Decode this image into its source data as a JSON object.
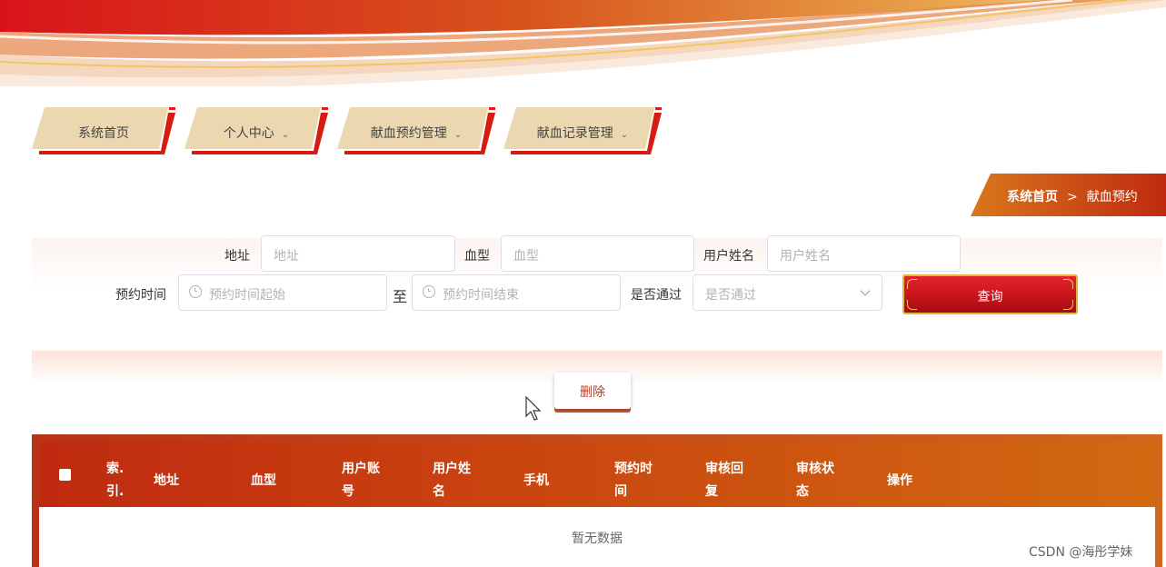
{
  "nav": {
    "items": [
      {
        "label": "系统首页",
        "has_dropdown": false
      },
      {
        "label": "个人中心",
        "has_dropdown": true
      },
      {
        "label": "献血预约管理",
        "has_dropdown": true
      },
      {
        "label": "献血记录管理",
        "has_dropdown": true
      }
    ],
    "dropdown_icon": "chevron-down-icon"
  },
  "breadcrumb": {
    "home": "系统首页",
    "separator": ">",
    "current": "献血预约"
  },
  "search": {
    "address": {
      "label": "地址",
      "placeholder": "地址"
    },
    "blood_type": {
      "label": "血型",
      "placeholder": "血型"
    },
    "user_name": {
      "label": "用户姓名",
      "placeholder": "用户姓名"
    },
    "time": {
      "label": "预约时间",
      "start_placeholder": "预约时间起始",
      "range_sep": "至",
      "end_placeholder": "预约时间结束",
      "icon": "clock-icon"
    },
    "passed": {
      "label": "是否通过",
      "placeholder": "是否通过",
      "icon": "chevron-down-icon"
    },
    "query_label": "查询"
  },
  "actions": {
    "delete_label": "删除"
  },
  "table": {
    "columns": [
      {
        "label": "索.",
        "label2": "引."
      },
      {
        "label": "地址",
        "label2": ""
      },
      {
        "label": "血型",
        "label2": ""
      },
      {
        "label": "用户账",
        "label2": "号"
      },
      {
        "label": "用户姓",
        "label2": "名"
      },
      {
        "label": "手机",
        "label2": ""
      },
      {
        "label": "预约时",
        "label2": "间"
      },
      {
        "label": "审核回",
        "label2": "复"
      },
      {
        "label": "审核状",
        "label2": "态"
      },
      {
        "label": "操作",
        "label2": ""
      }
    ],
    "empty_text": "暂无数据"
  },
  "watermark": "CSDN @海彤学妹",
  "colors": {
    "primary_red": "#c8141b",
    "gold": "#e7b33a",
    "orange": "#d26a12",
    "tab_beige": "#ecd8b0"
  }
}
